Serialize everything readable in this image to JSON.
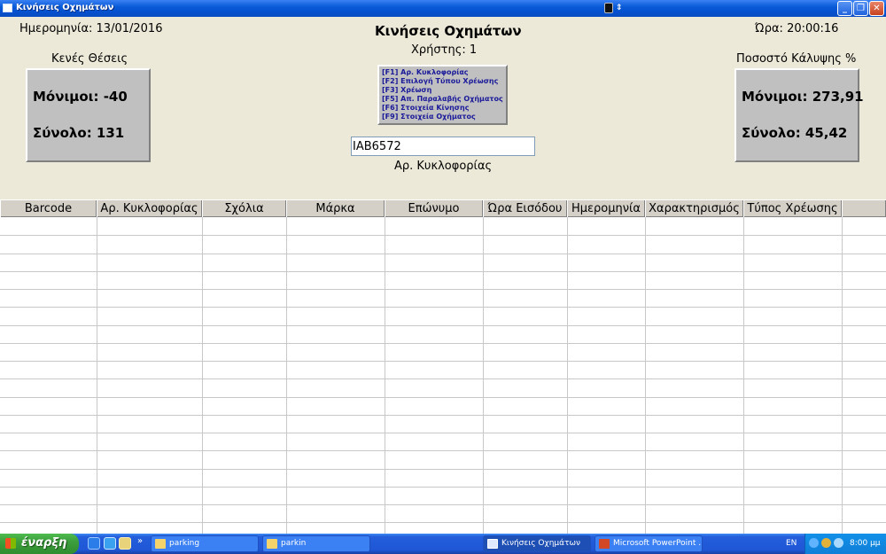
{
  "window": {
    "title": "Κινήσεις Οχημάτων"
  },
  "header": {
    "date_label": "Ημερομηνία: 13/01/2016",
    "time_label": "Ώρα: 20:00:16",
    "main_title": "Κινήσεις Οχημάτων",
    "user_label": "Χρήστης: 1"
  },
  "empty_slots": {
    "title": "Κενές Θέσεις",
    "permanent": "Μόνιμοι:  -40",
    "total": "Σύνολο:  131"
  },
  "coverage": {
    "title": "Ποσοστό Κάλυψης %",
    "permanent": "Μόνιμοι:  273,91",
    "total": "Σύνολο:   45,42"
  },
  "function_keys": [
    "[F1]  Αρ. Κυκλοφορίας",
    "[F2]  Επιλογή Τύπου Χρέωσης",
    "[F3]  Χρέωση",
    "[F5]  Απ. Παραλαβής Οχήματος",
    "[F6]  Στοιχεία Κίνησης",
    "[F9]  Στοιχεία Οχήματος"
  ],
  "plate": {
    "value": "IAB6572",
    "caption": "Αρ. Κυκλοφορίας"
  },
  "grid": {
    "columns": [
      "Barcode",
      "Αρ. Κυκλοφορίας",
      "Σχόλια",
      "Μάρκα",
      "Επώνυμο",
      "Ώρα Εισόδου",
      "Ημερομηνία",
      "Χαρακτηρισμός",
      "Τύπος Χρέωσης",
      ""
    ]
  },
  "taskbar": {
    "start_label": "έναρξη",
    "tasks": [
      "parking",
      "parkin",
      "Κινήσεις Οχημάτων",
      "Microsoft PowerPoint ..."
    ],
    "language": "EN",
    "clock": "8:00 μμ"
  },
  "colors": {
    "window_bg": "#ECE9D8",
    "panel_gray": "#C0C0C0",
    "title_blue": "#0A5BD8",
    "taskbar_blue": "#245EDB",
    "start_green": "#3C9E3C"
  }
}
